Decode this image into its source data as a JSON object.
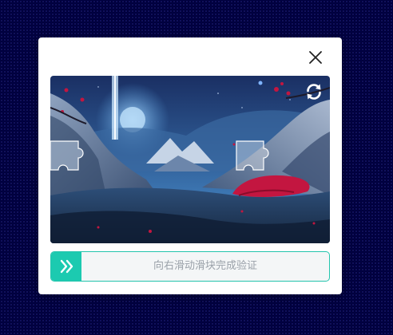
{
  "dialog": {
    "close_icon": "close-icon",
    "refresh_icon": "refresh-icon",
    "image_description_icon": "puzzle-piece-icon"
  },
  "slider": {
    "hint": "向右滑动滑块完成验证",
    "handle_icon": "double-chevron-right-icon",
    "accent_color": "#1ccab0",
    "progress": 0
  }
}
